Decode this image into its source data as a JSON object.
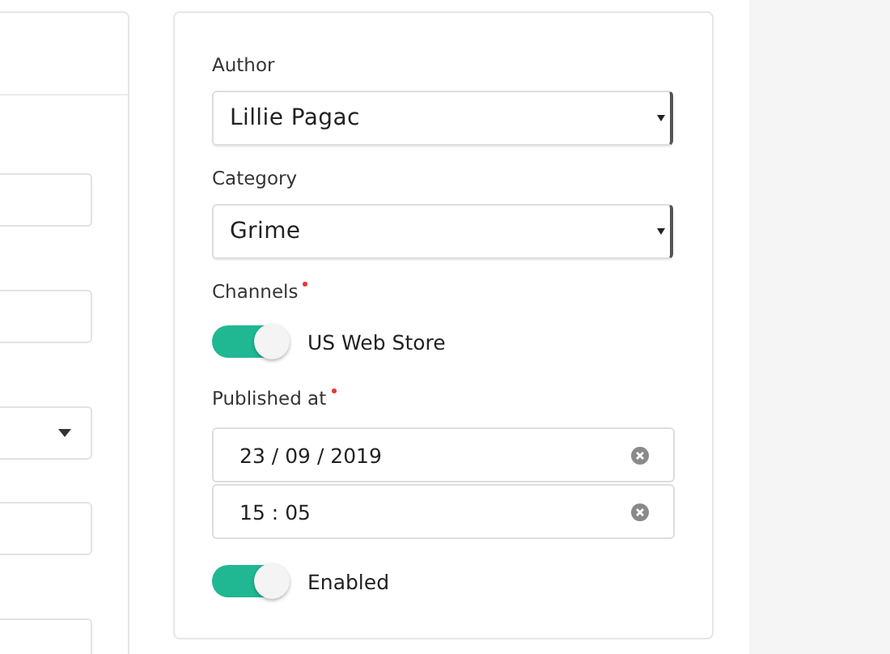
{
  "left_fields": [
    {
      "kind": "text"
    },
    {
      "kind": "text"
    },
    {
      "kind": "select"
    },
    {
      "kind": "text"
    },
    {
      "kind": "text"
    }
  ],
  "author": {
    "label": "Author",
    "value": "Lillie Pagac"
  },
  "category": {
    "label": "Category",
    "value": "Grime"
  },
  "channels": {
    "label": "Channels",
    "required": true,
    "items": [
      {
        "label": "US Web Store",
        "on": true
      }
    ]
  },
  "published_at": {
    "label": "Published at",
    "required": true,
    "date": "23 / 09 / 2019",
    "time": "15 : 05"
  },
  "enabled": {
    "label": "Enabled",
    "on": true
  }
}
